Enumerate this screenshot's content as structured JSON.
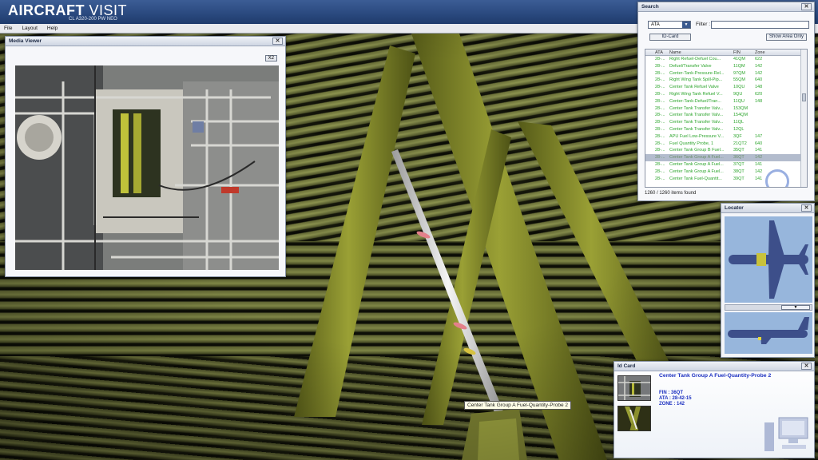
{
  "app": {
    "title_bold": "AIRCRAFT",
    "title_light": " VISIT",
    "subtitle": "CL A320-200 PW NEO"
  },
  "menu": [
    "File",
    "Layout",
    "Help"
  ],
  "media_viewer": {
    "title": "Media Viewer",
    "close_label": "✕",
    "zoom_label": "X2"
  },
  "search": {
    "title": "Search",
    "close_label": "✕",
    "select_value": "ATA",
    "filter_label": "Filter :",
    "filter_value": "",
    "idcard_button": "ID-Card",
    "show_area_button": "Show Area Only",
    "columns": {
      "ata": "ATA",
      "name": "Name",
      "fin": "FIN",
      "zone": "Zone"
    },
    "rows": [
      {
        "ata": "28-...",
        "name": "Right Refuel-Defuel Cou...",
        "fin": "41QM",
        "zone": "622"
      },
      {
        "ata": "28-...",
        "name": "Defuel/Transfer Valve",
        "fin": "11QM",
        "zone": "142"
      },
      {
        "ata": "28-...",
        "name": "Center-Tank-Pressure-Rel...",
        "fin": "97QM",
        "zone": "142"
      },
      {
        "ata": "28-...",
        "name": "Right Wing Tank Spill-Pip...",
        "fin": "55QM",
        "zone": "640"
      },
      {
        "ata": "28-...",
        "name": "Center Tank Refuel Valve",
        "fin": "10QU",
        "zone": "148"
      },
      {
        "ata": "28-...",
        "name": "Right Wing Tank Refuel V...",
        "fin": "9QU",
        "zone": "620"
      },
      {
        "ata": "28-...",
        "name": "Center-Tank-Defuel/Tran...",
        "fin": "11QU",
        "zone": "148"
      },
      {
        "ata": "28-...",
        "name": "Center Tank Transfer Valv...",
        "fin": "153QM",
        "zone": ""
      },
      {
        "ata": "28-...",
        "name": "Center Tank Transfer Valv...",
        "fin": "154QM",
        "zone": ""
      },
      {
        "ata": "28-...",
        "name": "Center Tank Transfer Valv...",
        "fin": "11QL",
        "zone": ""
      },
      {
        "ata": "28-...",
        "name": "Center Tank Transfer Valv...",
        "fin": "12QL",
        "zone": ""
      },
      {
        "ata": "28-...",
        "name": "APU Fuel Low-Pressure V...",
        "fin": "3QF",
        "zone": "147"
      },
      {
        "ata": "28-...",
        "name": "Fuel Quantity Probe, 1",
        "fin": "21QT2",
        "zone": "640"
      },
      {
        "ata": "28-...",
        "name": "Center Tank Group B Fuel...",
        "fin": "35QT",
        "zone": "141"
      },
      {
        "ata": "28-...",
        "name": "Center Tank Group A Fuel...",
        "fin": "36QT",
        "zone": "142",
        "selected": true
      },
      {
        "ata": "28-...",
        "name": "Center Tank Group A Fuel...",
        "fin": "37QT",
        "zone": "141"
      },
      {
        "ata": "28-...",
        "name": "Center Tank Group A Fuel...",
        "fin": "38QT",
        "zone": "142"
      },
      {
        "ata": "28-...",
        "name": "Center Tank Fuel-Quantit...",
        "fin": "39QT",
        "zone": "141"
      }
    ],
    "count": "1260 / 1260 items found"
  },
  "locator": {
    "title": "Locator",
    "close_label": "✕"
  },
  "id_card": {
    "title": "Id Card",
    "item_name": "Center Tank Group A Fuel-Quantity-Probe 2",
    "fin": "FIN : 36QT",
    "ata": "ATA : 28-42-15",
    "zone": "ZONE : 142"
  },
  "tooltip": "Center Tank Group A Fuel-Quantity-Probe 2",
  "colors": {
    "title_bar": "#2b4a80",
    "list_text": "#2da52d",
    "card_text": "#1b2fc0",
    "strut": "#8a8f2c"
  }
}
